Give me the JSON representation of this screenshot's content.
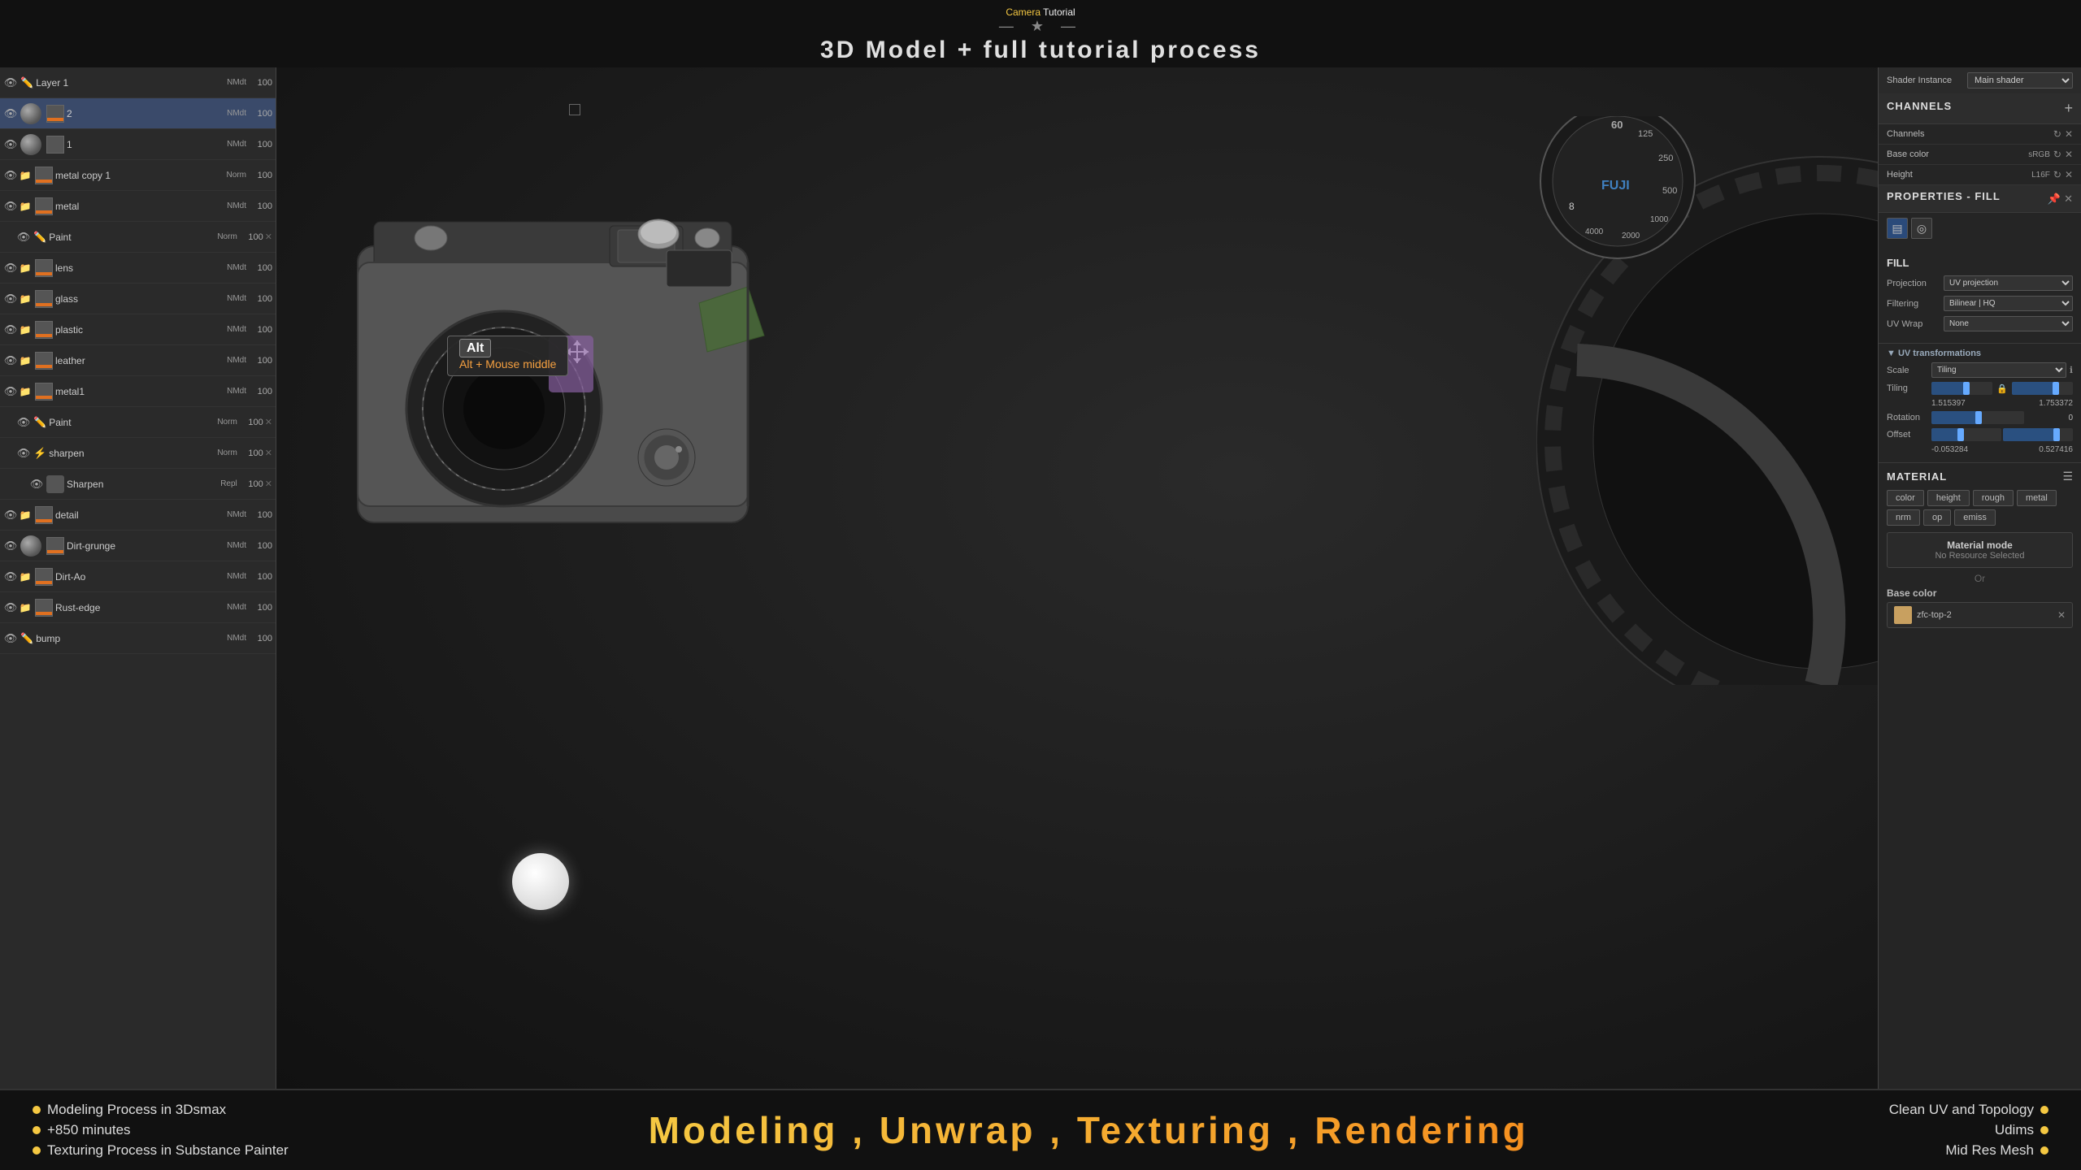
{
  "title": {
    "part1": "Camera",
    "part2": " Tutorial",
    "subtitle_divider": "— ★ —",
    "subtitle": "3D Model + full tutorial process"
  },
  "layers": [
    {
      "id": "layer1",
      "name": "Layer 1",
      "mode": "NMdt",
      "opacity": "100",
      "type": "paint",
      "indent": 0,
      "visible": true,
      "selected": false
    },
    {
      "id": "layer2",
      "name": "2",
      "mode": "NMdt",
      "opacity": "100",
      "type": "sphere",
      "indent": 0,
      "visible": true,
      "selected": true
    },
    {
      "id": "layer3",
      "name": "1",
      "mode": "NMdt",
      "opacity": "100",
      "type": "box",
      "indent": 0,
      "visible": true,
      "selected": false
    },
    {
      "id": "metal_copy",
      "name": "metal copy 1",
      "mode": "Norm",
      "opacity": "100",
      "type": "folder",
      "indent": 0,
      "visible": true,
      "selected": false
    },
    {
      "id": "metal",
      "name": "metal",
      "mode": "NMdt",
      "opacity": "100",
      "type": "folder",
      "indent": 0,
      "visible": true,
      "selected": false
    },
    {
      "id": "paint1",
      "name": "Paint",
      "mode": "Norm",
      "opacity": "100",
      "type": "paint_sub",
      "indent": 1,
      "visible": true,
      "selected": false
    },
    {
      "id": "lens",
      "name": "lens",
      "mode": "NMdt",
      "opacity": "100",
      "type": "folder",
      "indent": 0,
      "visible": true,
      "selected": false
    },
    {
      "id": "glass",
      "name": "glass",
      "mode": "NMdt",
      "opacity": "100",
      "type": "folder",
      "indent": 0,
      "visible": true,
      "selected": false
    },
    {
      "id": "plastic",
      "name": "plastic",
      "mode": "NMdt",
      "opacity": "100",
      "type": "folder",
      "indent": 0,
      "visible": true,
      "selected": false
    },
    {
      "id": "leather",
      "name": "leather",
      "mode": "NMdt",
      "opacity": "100",
      "type": "folder",
      "indent": 0,
      "visible": true,
      "selected": false
    },
    {
      "id": "metal1",
      "name": "metal1",
      "mode": "NMdt",
      "opacity": "100",
      "type": "folder",
      "indent": 0,
      "visible": true,
      "selected": false
    },
    {
      "id": "paint2",
      "name": "Paint",
      "mode": "Norm",
      "opacity": "100",
      "type": "paint_sub",
      "indent": 1,
      "visible": true,
      "selected": false
    },
    {
      "id": "sharpen_fx",
      "name": "sharpen",
      "mode": "Norm",
      "opacity": "100",
      "type": "fx",
      "indent": 1,
      "visible": true,
      "selected": false
    },
    {
      "id": "sharpen_layer",
      "name": "Sharpen",
      "mode": "Repl",
      "opacity": "100",
      "type": "fx_layer",
      "indent": 2,
      "visible": true,
      "selected": false
    },
    {
      "id": "detail",
      "name": "detail",
      "mode": "NMdt",
      "opacity": "100",
      "type": "folder",
      "indent": 0,
      "visible": true,
      "selected": false
    },
    {
      "id": "dirt_grunge",
      "name": "Dirt-grunge",
      "mode": "NMdt",
      "opacity": "100",
      "type": "sphere_folder",
      "indent": 0,
      "visible": true,
      "selected": false
    },
    {
      "id": "dirt_ao",
      "name": "Dirt-Ao",
      "mode": "NMdt",
      "opacity": "100",
      "type": "folder",
      "indent": 0,
      "visible": true,
      "selected": false
    },
    {
      "id": "rust_edge",
      "name": "Rust-edge",
      "mode": "NMdt",
      "opacity": "100",
      "type": "folder",
      "indent": 0,
      "visible": true,
      "selected": false
    },
    {
      "id": "bump",
      "name": "bump",
      "mode": "NMdt",
      "opacity": "100",
      "type": "paint",
      "indent": 0,
      "visible": true,
      "selected": false
    }
  ],
  "right_panel": {
    "shader_instance_label": "Shader Instance",
    "shader_instance_value": "Main shader",
    "channels_title": "CHANNELS",
    "channels_add": "+",
    "channels": [
      {
        "name": "Channels",
        "info": "",
        "type": "header"
      },
      {
        "name": "Base color",
        "info": "sRGB",
        "type": "channel"
      },
      {
        "name": "Height",
        "info": "L16F",
        "type": "channel"
      }
    ],
    "properties_fill_title": "PROPERTIES - FILL",
    "fill_title": "FILL",
    "fill_projection_label": "Projection",
    "fill_projection_value": "UV projection",
    "fill_filtering_label": "Filtering",
    "fill_filtering_value": "Bilinear | HQ",
    "fill_uvwrap_label": "UV Wrap",
    "fill_uvwrap_value": "None",
    "uv_transforms_title": "UV transformations",
    "uv_scale_label": "Scale",
    "uv_scale_value": "Tiling",
    "uv_tiling_label": "Tiling",
    "uv_tiling_x": "1.515397",
    "uv_tiling_y": "1.753372",
    "uv_rotation_label": "Rotation",
    "uv_rotation_value": "0",
    "uv_offset_label": "Offset",
    "uv_offset_x": "-0.053284",
    "uv_offset_y": "0.527416",
    "material_title": "MATERIAL",
    "material_buttons": [
      {
        "label": "color",
        "active": false
      },
      {
        "label": "height",
        "active": false
      },
      {
        "label": "rough",
        "active": false
      },
      {
        "label": "metal",
        "active": false
      },
      {
        "label": "nrm",
        "active": false
      },
      {
        "label": "op",
        "active": false
      },
      {
        "label": "emiss",
        "active": false
      }
    ],
    "material_mode_title": "Material mode",
    "material_mode_sub": "No Resource Selected",
    "or_label": "Or",
    "base_color_label": "Base color",
    "base_color_value": "zfc-top-2"
  },
  "viewport": {
    "alt_tooltip_label": "Alt",
    "alt_tooltip_sub": "Alt + Mouse middle"
  },
  "bottom_bar": {
    "left_items": [
      "Modeling Process in 3Dsmax",
      "+850 minutes",
      "Texturing Process in Substance Painter"
    ],
    "center": "Modeling , Unwrap , Texturing , Rendering",
    "right_items": [
      "Clean UV and Topology",
      "Udims",
      "Mid Res Mesh"
    ]
  }
}
